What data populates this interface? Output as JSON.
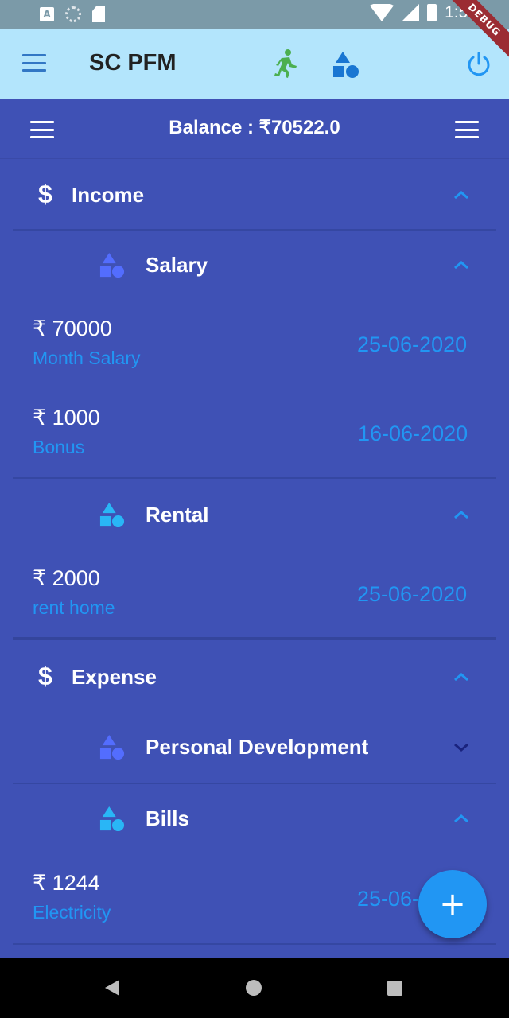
{
  "status_bar": {
    "time": "1:58",
    "debug_label": "DEBUG"
  },
  "app_bar": {
    "title": "SC PFM"
  },
  "balance": {
    "text": "Balance : ₹70522.0"
  },
  "sections": {
    "income": {
      "title": "Income",
      "salary": {
        "title": "Salary",
        "transactions": [
          {
            "amount": "₹ 70000",
            "note": "Month Salary",
            "date": "25-06-2020"
          },
          {
            "amount": "₹ 1000",
            "note": "Bonus",
            "date": "16-06-2020"
          }
        ]
      },
      "rental": {
        "title": "Rental",
        "transactions": [
          {
            "amount": "₹ 2000",
            "note": "rent home",
            "date": "25-06-2020"
          }
        ]
      }
    },
    "expense": {
      "title": "Expense",
      "personal_development": {
        "title": "Personal Development"
      },
      "bills": {
        "title": "Bills",
        "transactions": [
          {
            "amount": "₹ 1244",
            "note": "Electricity",
            "date": "25-06-2020"
          }
        ]
      }
    }
  },
  "fab": {
    "label": "+"
  },
  "colors": {
    "background": "#3f51b5",
    "app_bar": "#b3e5fc",
    "accent_blue": "#2196f3",
    "runner_green": "#4caf50"
  }
}
